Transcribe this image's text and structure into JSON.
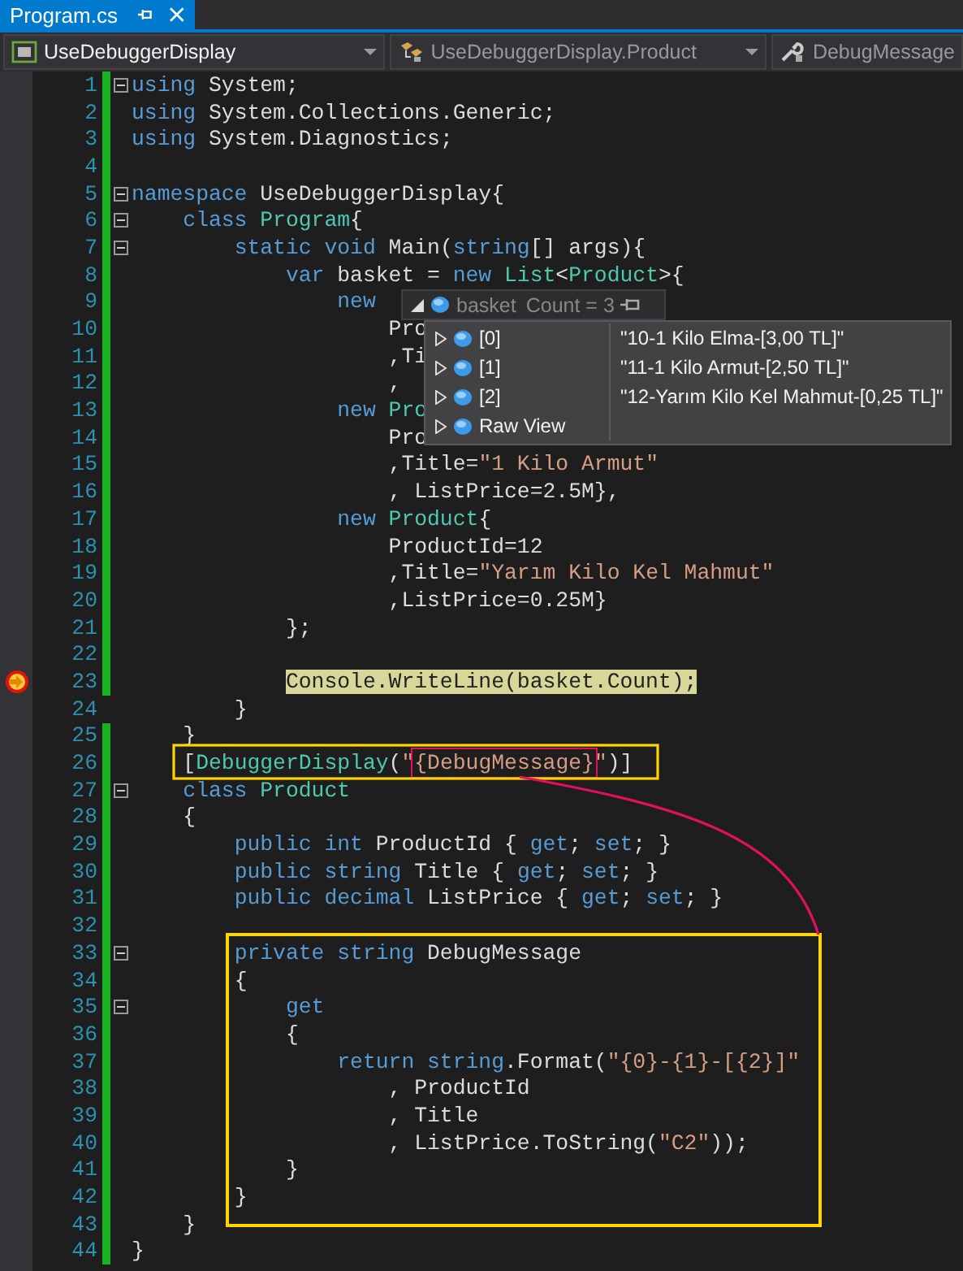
{
  "tab": {
    "title": "Program.cs",
    "selected": true
  },
  "nav": [
    {
      "text": "UseDebuggerDisplay",
      "kind": "project",
      "active": true
    },
    {
      "text": "UseDebuggerDisplay.Product",
      "kind": "class",
      "active": false
    },
    {
      "text": "DebugMessage",
      "kind": "member",
      "active": false
    }
  ],
  "lines": [
    {
      "number": "1",
      "changed": true,
      "fold": true,
      "current": false,
      "tokens": [
        {
          "kind": "kw",
          "text": "using"
        },
        {
          "kind": "plain",
          "text": " System;"
        }
      ]
    },
    {
      "number": "2",
      "changed": true,
      "fold": false,
      "current": false,
      "tokens": [
        {
          "kind": "kw",
          "text": "using"
        },
        {
          "kind": "plain",
          "text": " System.Collections.Generic;"
        }
      ]
    },
    {
      "number": "3",
      "changed": true,
      "fold": false,
      "current": false,
      "tokens": [
        {
          "kind": "kw",
          "text": "using"
        },
        {
          "kind": "plain",
          "text": " System.Diagnostics;"
        }
      ]
    },
    {
      "number": "4",
      "changed": true,
      "fold": false,
      "current": false
    },
    {
      "number": "5",
      "changed": true,
      "fold": true,
      "current": false,
      "tokens": [
        {
          "kind": "kw",
          "text": "namespace"
        },
        {
          "kind": "plain",
          "text": " UseDebuggerDisplay{"
        }
      ]
    },
    {
      "number": "6",
      "changed": true,
      "fold": true,
      "current": false,
      "tokens": [
        {
          "kind": "kw",
          "text": "    class "
        },
        {
          "kind": "type",
          "text": "Program"
        },
        {
          "kind": "plain",
          "text": "{"
        }
      ]
    },
    {
      "number": "7",
      "changed": true,
      "fold": true,
      "current": false,
      "tokens": [
        {
          "kind": "kw",
          "text": "        static void"
        },
        {
          "kind": "plain",
          "text": " Main("
        },
        {
          "kind": "kw",
          "text": "string"
        },
        {
          "kind": "plain",
          "text": "[] args){"
        }
      ]
    },
    {
      "number": "8",
      "changed": true,
      "fold": false,
      "current": false,
      "tokens": [
        {
          "kind": "kw",
          "text": "            var"
        },
        {
          "kind": "plain",
          "text": " basket = "
        },
        {
          "kind": "kw",
          "text": "new "
        },
        {
          "kind": "type",
          "text": "List"
        },
        {
          "kind": "plain",
          "text": "<"
        },
        {
          "kind": "type",
          "text": "Product"
        },
        {
          "kind": "plain",
          "text": ">{"
        }
      ]
    },
    {
      "number": "9",
      "changed": true,
      "fold": false,
      "current": false,
      "tokens": [
        {
          "kind": "kw",
          "text": "                new"
        }
      ]
    },
    {
      "number": "10",
      "changed": true,
      "fold": false,
      "current": false,
      "tokens": [
        {
          "kind": "plain",
          "text": "                    Pro"
        }
      ]
    },
    {
      "number": "11",
      "changed": true,
      "fold": false,
      "current": false,
      "tokens": [
        {
          "kind": "plain",
          "text": "                    ,Ti"
        }
      ]
    },
    {
      "number": "12",
      "changed": true,
      "fold": false,
      "current": false,
      "tokens": [
        {
          "kind": "plain",
          "text": "                    ,"
        }
      ]
    },
    {
      "number": "13",
      "changed": true,
      "fold": false,
      "current": false,
      "tokens": [
        {
          "kind": "kw",
          "text": "                new "
        },
        {
          "kind": "type",
          "text": "Pro"
        }
      ]
    },
    {
      "number": "14",
      "changed": true,
      "fold": false,
      "current": false,
      "tokens": [
        {
          "kind": "plain",
          "text": "                    Pro"
        }
      ]
    },
    {
      "number": "15",
      "changed": true,
      "fold": false,
      "current": false,
      "tokens": [
        {
          "kind": "plain",
          "text": "                    ,Title="
        },
        {
          "kind": "str",
          "text": "\"1 Kilo Armut\""
        }
      ]
    },
    {
      "number": "16",
      "changed": true,
      "fold": false,
      "current": false,
      "tokens": [
        {
          "kind": "plain",
          "text": "                    , ListPrice=2.5M},"
        }
      ]
    },
    {
      "number": "17",
      "changed": true,
      "fold": false,
      "current": false,
      "tokens": [
        {
          "kind": "kw",
          "text": "                new "
        },
        {
          "kind": "type",
          "text": "Product"
        },
        {
          "kind": "plain",
          "text": "{"
        }
      ]
    },
    {
      "number": "18",
      "changed": true,
      "fold": false,
      "current": false,
      "tokens": [
        {
          "kind": "plain",
          "text": "                    ProductId=12"
        }
      ]
    },
    {
      "number": "19",
      "changed": true,
      "fold": false,
      "current": false,
      "tokens": [
        {
          "kind": "plain",
          "text": "                    ,Title="
        },
        {
          "kind": "str",
          "text": "\"Yarım Kilo Kel Mahmut\""
        }
      ]
    },
    {
      "number": "20",
      "changed": true,
      "fold": false,
      "current": false,
      "tokens": [
        {
          "kind": "plain",
          "text": "                    ,ListPrice=0.25M}"
        }
      ]
    },
    {
      "number": "21",
      "changed": true,
      "fold": false,
      "current": false,
      "tokens": [
        {
          "kind": "plain",
          "text": "            };"
        }
      ]
    },
    {
      "number": "22",
      "changed": true,
      "fold": false,
      "current": false
    },
    {
      "number": "23",
      "changed": true,
      "fold": false,
      "current": true,
      "tokens": [
        {
          "kind": "plain",
          "text": "            Console.WriteLine(basket.Count);"
        }
      ]
    },
    {
      "number": "24",
      "changed": false,
      "fold": false,
      "current": false,
      "tokens": [
        {
          "kind": "plain",
          "text": "        }"
        }
      ]
    },
    {
      "number": "25",
      "changed": true,
      "fold": false,
      "current": false,
      "tokens": [
        {
          "kind": "plain",
          "text": "    }"
        }
      ]
    },
    {
      "number": "26",
      "changed": true,
      "fold": false,
      "current": false,
      "tokens": [
        {
          "kind": "plain",
          "text": "    ["
        },
        {
          "kind": "type",
          "text": "DebuggerDisplay"
        },
        {
          "kind": "plain",
          "text": "("
        },
        {
          "kind": "str",
          "text": "\""
        },
        {
          "kind": "framed",
          "text": "{DebugMessage}"
        },
        {
          "kind": "str",
          "text": "\""
        },
        {
          "kind": "plain",
          "text": ")]"
        }
      ]
    },
    {
      "number": "27",
      "changed": true,
      "fold": true,
      "current": false,
      "tokens": [
        {
          "kind": "kw",
          "text": "    class "
        },
        {
          "kind": "type",
          "text": "Product"
        }
      ]
    },
    {
      "number": "28",
      "changed": true,
      "fold": false,
      "current": false,
      "tokens": [
        {
          "kind": "plain",
          "text": "    {"
        }
      ]
    },
    {
      "number": "29",
      "changed": true,
      "fold": false,
      "current": false,
      "tokens": [
        {
          "kind": "kw",
          "text": "        public int"
        },
        {
          "kind": "plain",
          "text": " ProductId { "
        },
        {
          "kind": "kw",
          "text": "get"
        },
        {
          "kind": "plain",
          "text": "; "
        },
        {
          "kind": "kw",
          "text": "set"
        },
        {
          "kind": "plain",
          "text": "; }"
        }
      ]
    },
    {
      "number": "30",
      "changed": true,
      "fold": false,
      "current": false,
      "tokens": [
        {
          "kind": "kw",
          "text": "        public string"
        },
        {
          "kind": "plain",
          "text": " Title { "
        },
        {
          "kind": "kw",
          "text": "get"
        },
        {
          "kind": "plain",
          "text": "; "
        },
        {
          "kind": "kw",
          "text": "set"
        },
        {
          "kind": "plain",
          "text": "; }"
        }
      ]
    },
    {
      "number": "31",
      "changed": true,
      "fold": false,
      "current": false,
      "tokens": [
        {
          "kind": "kw",
          "text": "        public decimal"
        },
        {
          "kind": "plain",
          "text": " ListPrice { "
        },
        {
          "kind": "kw",
          "text": "get"
        },
        {
          "kind": "plain",
          "text": "; "
        },
        {
          "kind": "kw",
          "text": "set"
        },
        {
          "kind": "plain",
          "text": "; }"
        }
      ]
    },
    {
      "number": "32",
      "changed": true,
      "fold": false,
      "current": false
    },
    {
      "number": "33",
      "changed": true,
      "fold": true,
      "current": false,
      "tokens": [
        {
          "kind": "kw",
          "text": "        private string"
        },
        {
          "kind": "plain",
          "text": " DebugMessage"
        }
      ]
    },
    {
      "number": "34",
      "changed": true,
      "fold": false,
      "current": false,
      "tokens": [
        {
          "kind": "plain",
          "text": "        {"
        }
      ]
    },
    {
      "number": "35",
      "changed": true,
      "fold": true,
      "current": false,
      "tokens": [
        {
          "kind": "kw",
          "text": "            get"
        }
      ]
    },
    {
      "number": "36",
      "changed": true,
      "fold": false,
      "current": false,
      "tokens": [
        {
          "kind": "plain",
          "text": "            {"
        }
      ]
    },
    {
      "number": "37",
      "changed": true,
      "fold": false,
      "current": false,
      "tokens": [
        {
          "kind": "kw",
          "text": "                return string"
        },
        {
          "kind": "plain",
          "text": ".Format("
        },
        {
          "kind": "str",
          "text": "\"{0}-{1}-[{2}]\""
        }
      ]
    },
    {
      "number": "38",
      "changed": true,
      "fold": false,
      "current": false,
      "tokens": [
        {
          "kind": "plain",
          "text": "                    , ProductId"
        }
      ]
    },
    {
      "number": "39",
      "changed": true,
      "fold": false,
      "current": false,
      "tokens": [
        {
          "kind": "plain",
          "text": "                    , Title"
        }
      ]
    },
    {
      "number": "40",
      "changed": true,
      "fold": false,
      "current": false,
      "tokens": [
        {
          "kind": "plain",
          "text": "                    , ListPrice.ToString("
        },
        {
          "kind": "str",
          "text": "\"C2\""
        },
        {
          "kind": "plain",
          "text": "));"
        }
      ]
    },
    {
      "number": "41",
      "changed": true,
      "fold": false,
      "current": false,
      "tokens": [
        {
          "kind": "plain",
          "text": "            }"
        }
      ]
    },
    {
      "number": "42",
      "changed": true,
      "fold": false,
      "current": false,
      "tokens": [
        {
          "kind": "plain",
          "text": "        }"
        }
      ]
    },
    {
      "number": "43",
      "changed": true,
      "fold": false,
      "current": false,
      "tokens": [
        {
          "kind": "plain",
          "text": "    }"
        }
      ]
    },
    {
      "number": "44",
      "changed": true,
      "fold": false,
      "current": false,
      "tokens": [
        {
          "kind": "plain",
          "text": "}"
        }
      ]
    }
  ],
  "datatip": {
    "expression": "basket",
    "value": "Count = 3",
    "rows": [
      {
        "name": "[0]",
        "value": "\"10-1 Kilo Elma-[3,00 TL]\""
      },
      {
        "name": "[1]",
        "value": "\"11-1 Kilo Armut-[2,50 TL]\""
      },
      {
        "name": "[2]",
        "value": "\"12-Yarım Kilo Kel Mahmut-[0,25 TL]\""
      },
      {
        "name": "Raw View"
      }
    ]
  }
}
